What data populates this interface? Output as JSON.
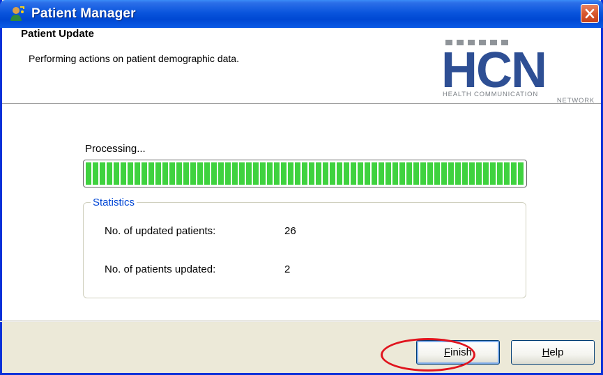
{
  "window": {
    "title": "Patient Manager",
    "title_icon": "patient-manager-app-icon",
    "close_icon": "close-icon"
  },
  "header": {
    "title": "Patient Update",
    "subtitle": "Performing actions on patient demographic data."
  },
  "logo": {
    "letters": "HCN",
    "line1": "HEALTH COMMUNICATION",
    "line2": "NETWORK",
    "color": "#2e4f94"
  },
  "progress": {
    "label": "Processing...",
    "percent": 100,
    "color": "#3fd23f"
  },
  "statistics": {
    "legend": "Statistics",
    "rows": [
      {
        "label": "No. of updated patients:",
        "value": "26"
      },
      {
        "label": "No. of patients updated:",
        "value": "2"
      }
    ]
  },
  "buttons": {
    "finish": {
      "mnemonic": "F",
      "rest": "inish"
    },
    "help": {
      "mnemonic": "H",
      "rest": "elp"
    }
  },
  "colors": {
    "titlebar": "#0a55dd",
    "legend_text": "#0046d5",
    "annotation": "#e0141e"
  }
}
